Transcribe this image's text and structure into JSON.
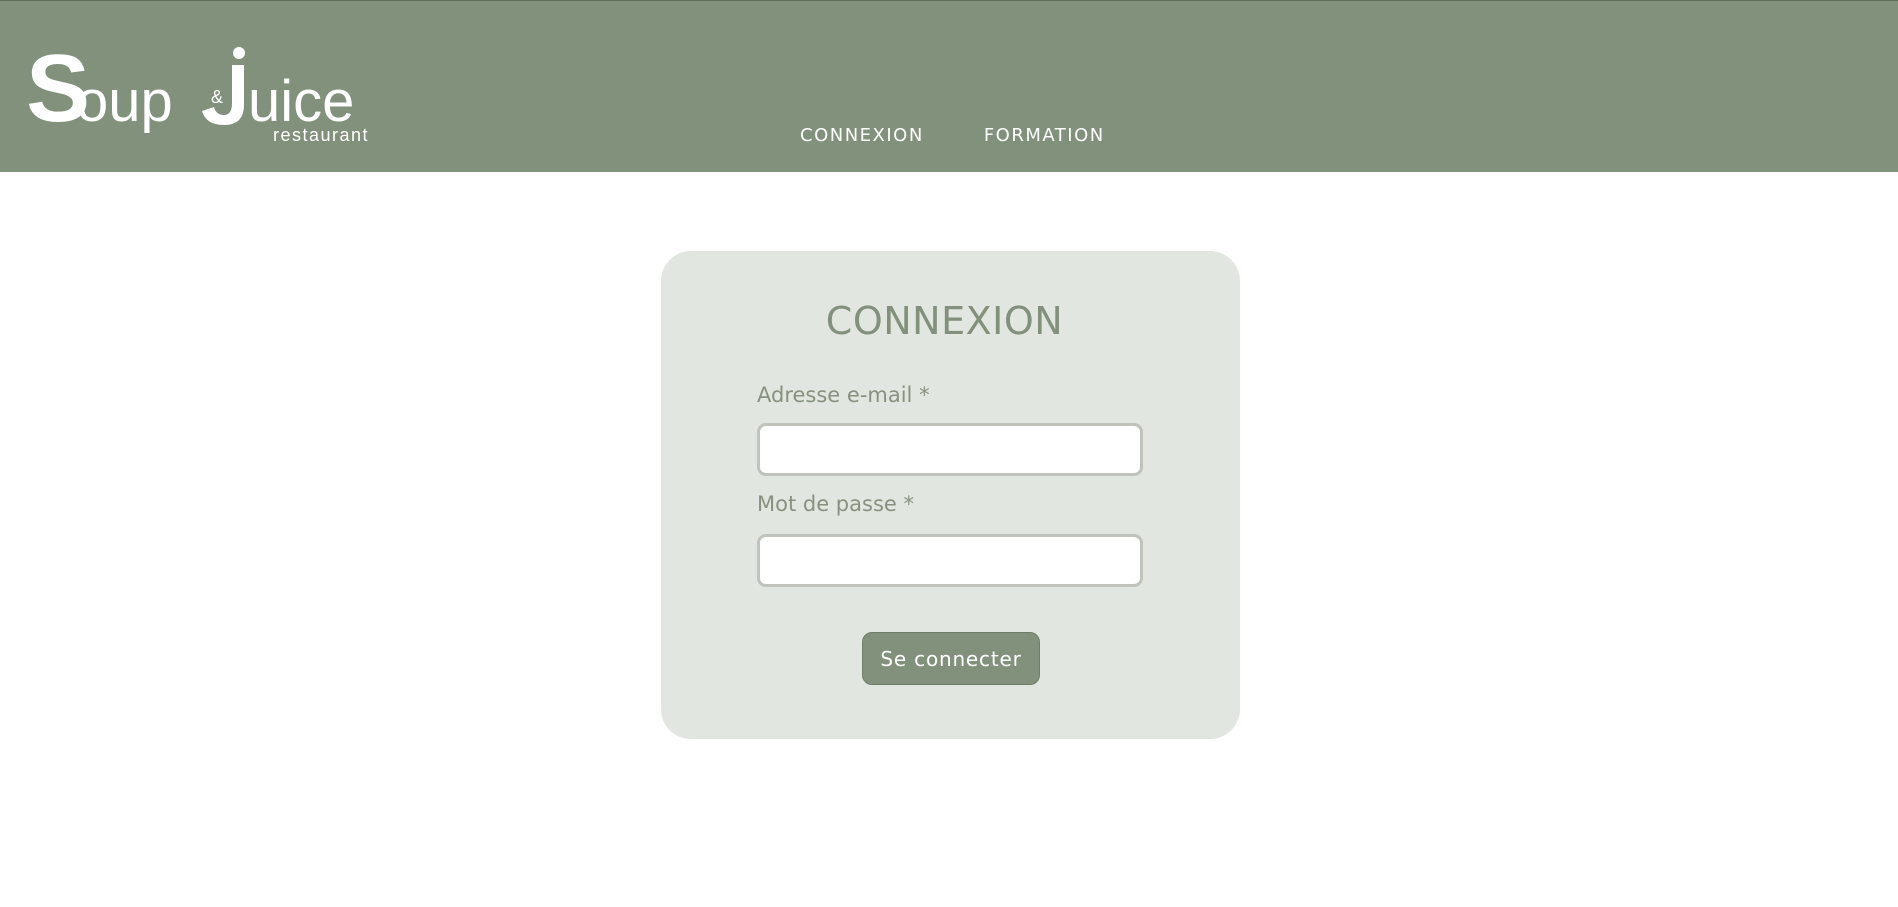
{
  "header": {
    "logo": {
      "text_main": "Soup",
      "text_amp": "&",
      "text_juice": "Juice",
      "text_sub": "restaurant"
    },
    "nav": [
      {
        "label": "CONNEXION"
      },
      {
        "label": "FORMATION"
      }
    ]
  },
  "login": {
    "title": "CONNEXION",
    "email_label": "Adresse e-mail *",
    "email_value": "",
    "password_label": "Mot de passe *",
    "password_value": "",
    "submit_label": "Se connecter"
  },
  "colors": {
    "header_bg": "#81917b",
    "card_bg": "#e2e6e0",
    "accent": "#82917b",
    "input_border": "#bfc3bb"
  }
}
